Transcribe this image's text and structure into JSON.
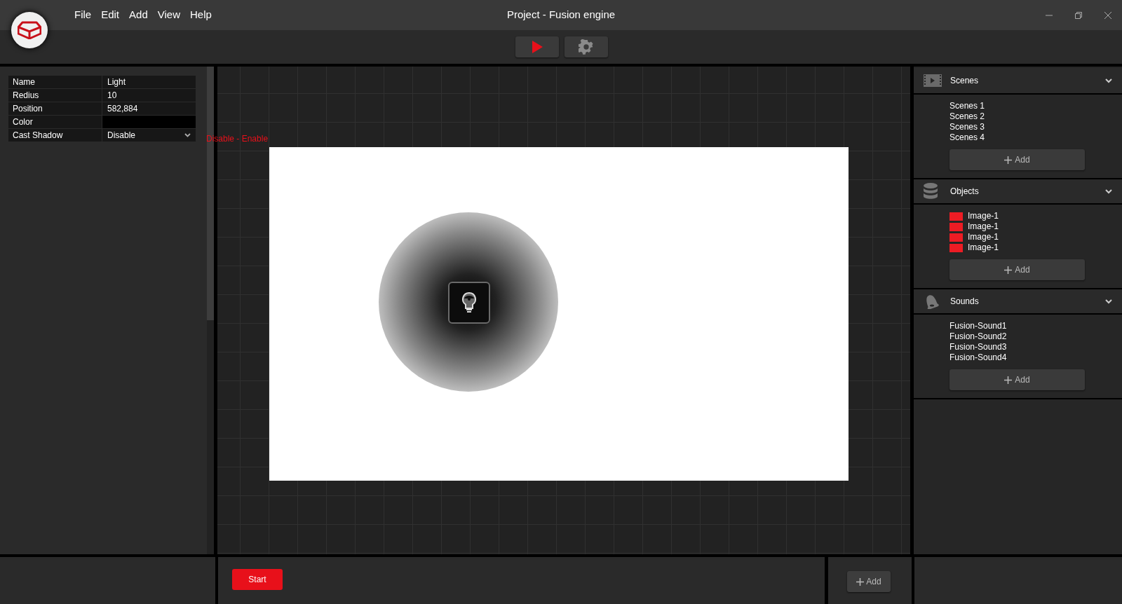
{
  "menu": [
    "File",
    "Edit",
    "Add",
    "View",
    "Help"
  ],
  "window": {
    "title": "Project - Fusion engine"
  },
  "properties": [
    {
      "label": "Name",
      "kind": "text",
      "value": "Light"
    },
    {
      "label": "Redius",
      "kind": "text",
      "value": "10"
    },
    {
      "label": "Position",
      "kind": "text",
      "value": "582,884"
    },
    {
      "label": "Color",
      "kind": "color",
      "color": "#000000"
    },
    {
      "label": "Cast Shadow",
      "kind": "select",
      "value": "Disable"
    }
  ],
  "canvas_hint": "Disable - Enable",
  "panels": [
    {
      "title": "Scenes",
      "expanded": true,
      "items": [
        {
          "label": "Scenes 1"
        },
        {
          "label": "Scenes 2"
        },
        {
          "label": "Scenes 3"
        },
        {
          "label": "Scenes 4"
        }
      ],
      "add_button": "Add"
    },
    {
      "title": "Objects",
      "expanded": true,
      "items": [
        {
          "label": "Image-1",
          "color": "#ed1c24"
        },
        {
          "label": "Image-1",
          "color": "#ed1c24"
        },
        {
          "label": "Image-1",
          "color": "#ed1c24"
        },
        {
          "label": "Image-1",
          "color": "#ed1c24"
        }
      ],
      "add_button": "Add"
    },
    {
      "title": "Sounds",
      "expanded": true,
      "items": [
        {
          "label": "Fusion-Sound1"
        },
        {
          "label": "Fusion-Sound2"
        },
        {
          "label": "Fusion-Sound3"
        },
        {
          "label": "Fusion-Sound4"
        }
      ],
      "add_button": "Add"
    }
  ],
  "bottom": {
    "start_button": "Start",
    "add_button": "Add"
  }
}
